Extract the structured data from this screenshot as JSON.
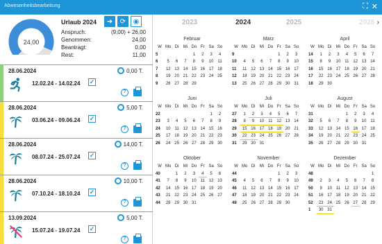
{
  "window": {
    "title": "Abwesenheitsbearbeitung",
    "icons": [
      "expand-icon",
      "close-icon"
    ]
  },
  "summary": {
    "title": "Urlaub 2024",
    "gauge_value": "24,00",
    "gauge_fraction": 0.92,
    "rows": [
      {
        "label": "Anspruch:",
        "value": "(9,00) + 26,00"
      },
      {
        "label": "Genommen:",
        "value": "24,00"
      },
      {
        "label": "Beantragt:",
        "value": "0,00"
      },
      {
        "label": "Rest:",
        "value": "11,00"
      }
    ],
    "colors": {
      "accent": "#1e95d6",
      "gauge_bg": "#e2e2e2"
    }
  },
  "entries": [
    {
      "date": "28.06.2024",
      "days": "0,00 T.",
      "range": "12.02.24 - 14.02.24",
      "icon": "running-person-icon",
      "bar": "#8fd17a"
    },
    {
      "date": "28.06.2024",
      "days": "5,00 T.",
      "range": "03.06.24 - 09.06.24",
      "icon": "palm-tree-icon",
      "bar": "#f6dd3a"
    },
    {
      "date": "28.06.2024",
      "days": "14,00 T.",
      "range": "08.07.24 - 25.07.24",
      "icon": "palm-tree-icon",
      "bar": "#f6dd3a"
    },
    {
      "date": "28.06.2024",
      "days": "10,00 T.",
      "range": "07.10.24 - 18.10.24",
      "icon": "palm-tree-icon",
      "bar": "#f6dd3a"
    },
    {
      "date": "13.09.2024",
      "days": "5,00 T.",
      "range": "15.07.24 - 19.07.24",
      "icon": "palm-tree-crossed-icon",
      "bar": "#f6dd3a"
    }
  ],
  "years": {
    "prev2": "2023",
    "current": "2024",
    "next": "2025",
    "next2": "2026",
    "arrow": "›"
  },
  "weekday_headers": [
    "W",
    "Mo",
    "Di",
    "Mi",
    "Do",
    "Fr",
    "Sa",
    "So"
  ],
  "months": [
    {
      "name": "Februar",
      "weeks": [
        {
          "w": "5",
          "days": [
            "",
            "",
            "",
            "1",
            "2",
            "3",
            "4"
          ]
        },
        {
          "w": "6",
          "days": [
            "5",
            "6",
            "7",
            "8",
            "9",
            "10",
            "11"
          ]
        },
        {
          "w": "7",
          "days": [
            "12",
            "13",
            "14",
            "15",
            "16",
            "17",
            "18"
          ]
        },
        {
          "w": "8",
          "days": [
            "19",
            "20",
            "21",
            "22",
            "23",
            "24",
            "25"
          ]
        },
        {
          "w": "9",
          "days": [
            "26",
            "27",
            "28",
            "29",
            "",
            "",
            ""
          ]
        }
      ],
      "gray": [
        "3",
        "4",
        "10",
        "11",
        "17",
        "18",
        "24",
        "25"
      ],
      "vac": []
    },
    {
      "name": "März",
      "weeks": [
        {
          "w": "9",
          "days": [
            "",
            "",
            "",
            "",
            "1",
            "2",
            "3"
          ]
        },
        {
          "w": "10",
          "days": [
            "4",
            "5",
            "6",
            "7",
            "8",
            "9",
            "10"
          ]
        },
        {
          "w": "11",
          "days": [
            "11",
            "12",
            "13",
            "14",
            "15",
            "16",
            "17"
          ]
        },
        {
          "w": "12",
          "days": [
            "18",
            "19",
            "20",
            "21",
            "22",
            "23",
            "24"
          ]
        },
        {
          "w": "13",
          "days": [
            "25",
            "26",
            "27",
            "28",
            "29",
            "30",
            "31"
          ]
        }
      ],
      "gray": [
        "2",
        "3",
        "9",
        "10",
        "16",
        "17",
        "23",
        "24",
        "29",
        "30",
        "31"
      ],
      "vac": []
    },
    {
      "name": "April",
      "weeks": [
        {
          "w": "14",
          "days": [
            "1",
            "2",
            "3",
            "4",
            "5",
            "6",
            "7"
          ]
        },
        {
          "w": "15",
          "days": [
            "8",
            "9",
            "10",
            "11",
            "12",
            "13",
            "14"
          ]
        },
        {
          "w": "16",
          "days": [
            "15",
            "16",
            "17",
            "18",
            "19",
            "20",
            "21"
          ]
        },
        {
          "w": "17",
          "days": [
            "22",
            "23",
            "24",
            "25",
            "26",
            "27",
            "28"
          ]
        },
        {
          "w": "18",
          "days": [
            "29",
            "30",
            "",
            "",
            "",
            "",
            ""
          ]
        }
      ],
      "gray": [
        "1",
        "6",
        "7",
        "13",
        "14",
        "20",
        "21",
        "27",
        "28"
      ],
      "vac": []
    },
    {
      "name": "Juni",
      "weeks": [
        {
          "w": "22",
          "days": [
            "",
            "",
            "",
            "",
            "",
            "1",
            "2"
          ]
        },
        {
          "w": "23",
          "days": [
            "3",
            "4",
            "5",
            "6",
            "7",
            "8",
            "9"
          ]
        },
        {
          "w": "24",
          "days": [
            "10",
            "11",
            "12",
            "13",
            "14",
            "15",
            "16"
          ]
        },
        {
          "w": "25",
          "days": [
            "17",
            "18",
            "19",
            "20",
            "21",
            "22",
            "23"
          ]
        },
        {
          "w": "26",
          "days": [
            "24",
            "25",
            "26",
            "27",
            "28",
            "29",
            "30"
          ]
        }
      ],
      "gray": [
        "1",
        "2",
        "8",
        "9",
        "15",
        "16",
        "22",
        "23",
        "29",
        "30"
      ],
      "vac": []
    },
    {
      "name": "Juli",
      "weeks": [
        {
          "w": "27",
          "days": [
            "1",
            "2",
            "3",
            "4",
            "5",
            "6",
            "7"
          ]
        },
        {
          "w": "28",
          "days": [
            "8",
            "9",
            "10",
            "11",
            "12",
            "13",
            "14"
          ]
        },
        {
          "w": "29",
          "days": [
            "15",
            "16",
            "17",
            "18",
            "19",
            "20",
            "21"
          ]
        },
        {
          "w": "30",
          "days": [
            "22",
            "23",
            "24",
            "25",
            "26",
            "27",
            "28"
          ]
        },
        {
          "w": "31",
          "days": [
            "29",
            "30",
            "31",
            "",
            "",
            "",
            ""
          ]
        }
      ],
      "gray": [
        "6",
        "7",
        "13",
        "14",
        "20",
        "21",
        "27",
        "28"
      ],
      "vac": [
        "2",
        "3",
        "4",
        "5",
        "8",
        "9",
        "10",
        "11",
        "12",
        "15",
        "16",
        "17",
        "18",
        "19",
        "22",
        "23"
      ]
    },
    {
      "name": "August",
      "weeks": [
        {
          "w": "31",
          "days": [
            "",
            "",
            "",
            "1",
            "2",
            "3",
            "4"
          ]
        },
        {
          "w": "32",
          "days": [
            "5",
            "6",
            "7",
            "8",
            "9",
            "10",
            "11"
          ]
        },
        {
          "w": "33",
          "days": [
            "12",
            "13",
            "14",
            "15",
            "16",
            "17",
            "18"
          ]
        },
        {
          "w": "34",
          "days": [
            "19",
            "20",
            "21",
            "22",
            "23",
            "24",
            "25"
          ]
        },
        {
          "w": "35",
          "days": [
            "26",
            "27",
            "28",
            "29",
            "30",
            "31",
            ""
          ]
        }
      ],
      "gray": [
        "3",
        "4",
        "10",
        "11",
        "17",
        "18",
        "24",
        "25",
        "31"
      ],
      "vac": [
        "16"
      ]
    },
    {
      "name": "Oktober",
      "weeks": [
        {
          "w": "40",
          "days": [
            "",
            "1",
            "2",
            "3",
            "4",
            "5",
            "6"
          ]
        },
        {
          "w": "41",
          "days": [
            "7",
            "8",
            "9",
            "10",
            "11",
            "12",
            "13"
          ]
        },
        {
          "w": "42",
          "days": [
            "14",
            "15",
            "16",
            "17",
            "18",
            "19",
            "20"
          ]
        },
        {
          "w": "43",
          "days": [
            "21",
            "22",
            "23",
            "24",
            "25",
            "26",
            "27"
          ]
        },
        {
          "w": "44",
          "days": [
            "28",
            "29",
            "30",
            "31",
            "",
            "",
            ""
          ]
        }
      ],
      "gray": [
        "3",
        "5",
        "6",
        "12",
        "13",
        "19",
        "20",
        "26",
        "27"
      ],
      "vac": [
        "4"
      ]
    },
    {
      "name": "November",
      "weeks": [
        {
          "w": "44",
          "days": [
            "",
            "",
            "",
            "",
            "1",
            "2",
            "3"
          ]
        },
        {
          "w": "45",
          "days": [
            "4",
            "5",
            "6",
            "7",
            "8",
            "9",
            "10"
          ]
        },
        {
          "w": "46",
          "days": [
            "11",
            "12",
            "13",
            "14",
            "15",
            "16",
            "17"
          ]
        },
        {
          "w": "47",
          "days": [
            "18",
            "19",
            "20",
            "21",
            "22",
            "23",
            "24"
          ]
        },
        {
          "w": "48",
          "days": [
            "25",
            "26",
            "27",
            "28",
            "29",
            "30",
            ""
          ]
        }
      ],
      "gray": [
        "2",
        "3",
        "9",
        "10",
        "16",
        "17",
        "23",
        "24",
        "30"
      ],
      "vac": []
    },
    {
      "name": "Dezember",
      "weeks": [
        {
          "w": "48",
          "days": [
            "",
            "",
            "",
            "",
            "",
            "",
            "1"
          ]
        },
        {
          "w": "49",
          "days": [
            "2",
            "3",
            "4",
            "5",
            "6",
            "7",
            "8"
          ]
        },
        {
          "w": "50",
          "days": [
            "9",
            "10",
            "11",
            "12",
            "13",
            "14",
            "15"
          ]
        },
        {
          "w": "51",
          "days": [
            "16",
            "17",
            "18",
            "19",
            "20",
            "21",
            "22"
          ]
        },
        {
          "w": "52",
          "days": [
            "23",
            "24",
            "25",
            "26",
            "27",
            "28",
            "29"
          ]
        },
        {
          "w": "1",
          "days": [
            "30",
            "31",
            "",
            "",
            "",
            "",
            ""
          ]
        }
      ],
      "gray": [
        "1",
        "7",
        "8",
        "14",
        "15",
        "21",
        "22",
        "24",
        "25",
        "26",
        "28",
        "29",
        "31"
      ],
      "vac": [
        "23",
        "24",
        "27",
        "30",
        "31"
      ]
    }
  ]
}
